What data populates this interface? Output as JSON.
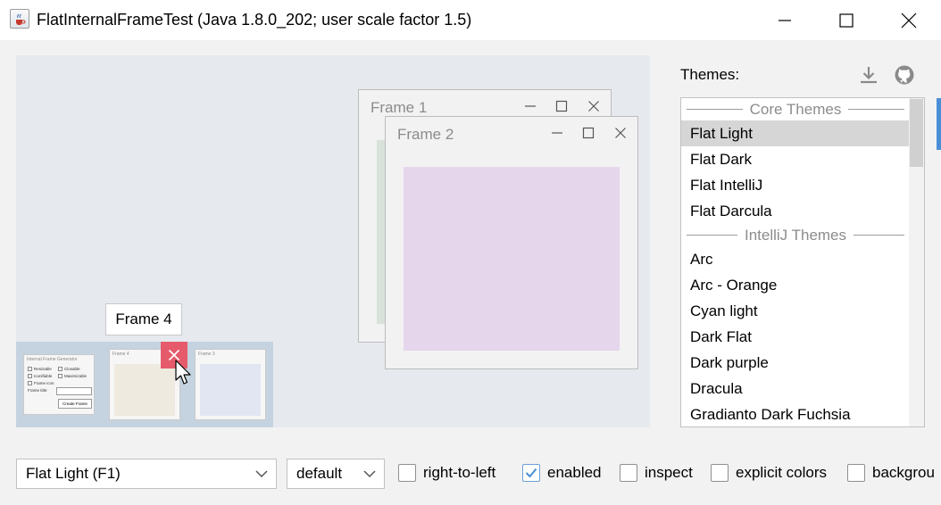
{
  "window": {
    "title": "FlatInternalFrameTest (Java 1.8.0_202;  user scale factor 1.5)"
  },
  "desktop": {
    "frame1": {
      "title": "Frame 1"
    },
    "frame2": {
      "title": "Frame 2"
    },
    "frame4_tooltip": "Frame 4",
    "thumbnails": {
      "generator": {
        "title": "Internal Frame Generator",
        "resizable": "Resizable",
        "closable": "Closable",
        "iconifiable": "Iconifiable",
        "maximizable": "Maximizable",
        "frame_icon": "Frame icon",
        "frame_title": "Frame title:",
        "create_button": "Create Frame"
      },
      "frame4": {
        "title": "Frame 4"
      },
      "frame3": {
        "title": "Frame 3"
      }
    }
  },
  "themes": {
    "label": "Themes:",
    "core_header": "Core Themes",
    "core": [
      "Flat Light",
      "Flat Dark",
      "Flat IntelliJ",
      "Flat Darcula"
    ],
    "intellij_header": "IntelliJ Themes",
    "intellij": [
      "Arc",
      "Arc - Orange",
      "Cyan light",
      "Dark Flat",
      "Dark purple",
      "Dracula",
      "Gradianto Dark Fuchsia"
    ],
    "selected": "Flat Light"
  },
  "controls": {
    "theme_combo": "Flat Light (F1)",
    "scale_combo": "default",
    "right_to_left": "right-to-left",
    "enabled": "enabled",
    "inspect": "inspect",
    "explicit_colors": "explicit colors",
    "background": "backgrou"
  },
  "colors": {
    "accent": "#4a8fd6",
    "close_hover": "#e55b6b",
    "frame2_content": "#e6d6eb",
    "frame1_content": "#d8e2da",
    "selected_row": "#d6d6d6"
  }
}
